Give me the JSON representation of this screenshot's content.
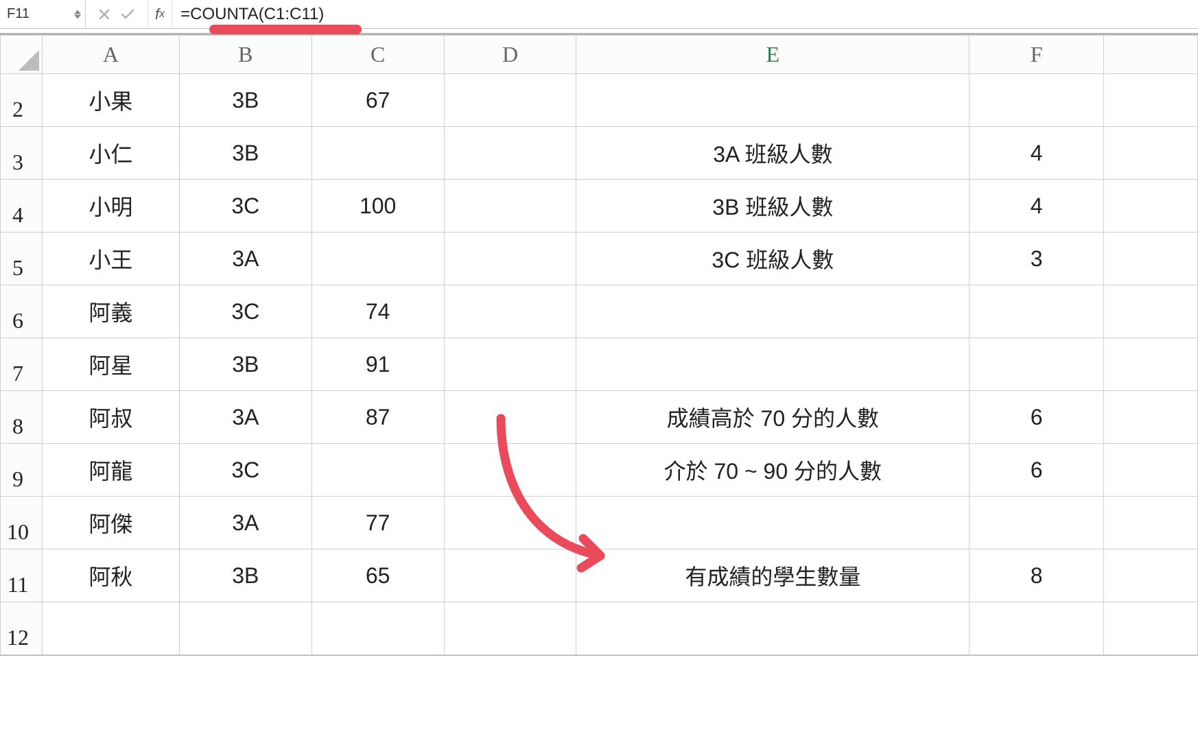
{
  "formula_bar": {
    "name_box": "F11",
    "formula": "=COUNTA(C1:C11)"
  },
  "columns": [
    "A",
    "B",
    "C",
    "D",
    "E",
    "F"
  ],
  "row_numbers": [
    2,
    3,
    4,
    5,
    6,
    7,
    8,
    9,
    10,
    11,
    12
  ],
  "rows": [
    {
      "A": "小果",
      "B": "3B",
      "C": "67",
      "D": "",
      "E": "",
      "F": ""
    },
    {
      "A": "小仁",
      "B": "3B",
      "C": "",
      "D": "",
      "E": "3A 班級人數",
      "F": "4"
    },
    {
      "A": "小明",
      "B": "3C",
      "C": "100",
      "D": "",
      "E": "3B 班級人數",
      "F": "4"
    },
    {
      "A": "小王",
      "B": "3A",
      "C": "",
      "D": "",
      "E": "3C 班級人數",
      "F": "3"
    },
    {
      "A": "阿義",
      "B": "3C",
      "C": "74",
      "D": "",
      "E": "",
      "F": ""
    },
    {
      "A": "阿星",
      "B": "3B",
      "C": "91",
      "D": "",
      "E": "",
      "F": ""
    },
    {
      "A": "阿叔",
      "B": "3A",
      "C": "87",
      "D": "",
      "E": "成績高於 70 分的人數",
      "F": "6"
    },
    {
      "A": "阿龍",
      "B": "3C",
      "C": "",
      "D": "",
      "E": "介於 70 ~ 90 分的人數",
      "F": "6"
    },
    {
      "A": "阿傑",
      "B": "3A",
      "C": "77",
      "D": "",
      "E": "",
      "F": ""
    },
    {
      "A": "阿秋",
      "B": "3B",
      "C": "65",
      "D": "",
      "E": "有成績的學生數量",
      "F": "8"
    },
    {
      "A": "",
      "B": "",
      "C": "",
      "D": "",
      "E": "",
      "F": ""
    }
  ],
  "annotations": {
    "underline_color": "#e94b5a",
    "arrow_color": "#e94b5a"
  }
}
